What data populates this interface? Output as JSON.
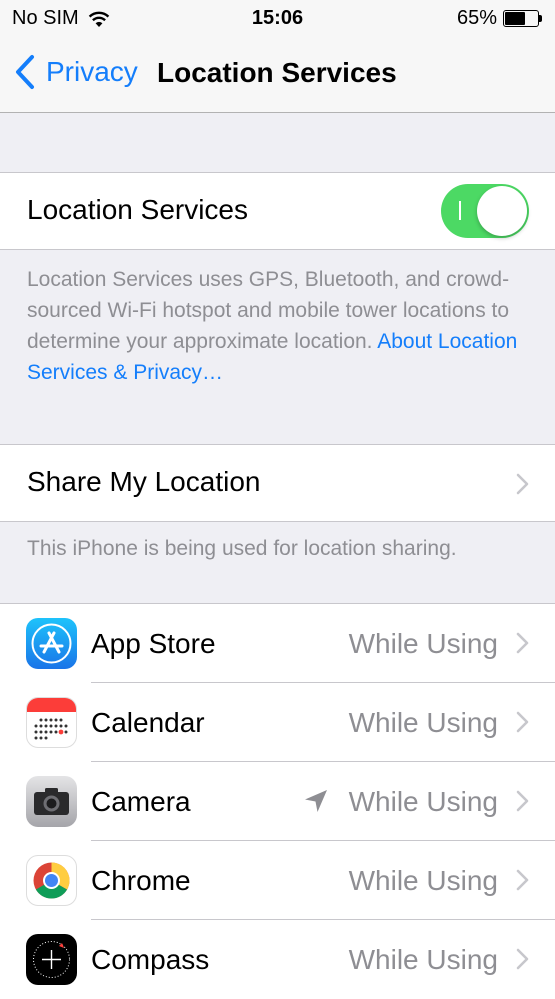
{
  "status_bar": {
    "carrier": "No SIM",
    "time": "15:06",
    "battery_percent_label": "65%",
    "battery_level": 0.65
  },
  "nav": {
    "back_label": "Privacy",
    "title": "Location Services"
  },
  "location_services": {
    "label": "Location Services",
    "enabled": true,
    "toggle_mark": "I",
    "description": "Location Services uses GPS, Bluetooth, and crowd-sourced Wi-Fi hotspot and mobile tower locations to determine your approximate location. ",
    "link": "About Location Services & Privacy…"
  },
  "share": {
    "label": "Share My Location",
    "footer": "This iPhone is being used for location sharing."
  },
  "apps": [
    {
      "name": "App Store",
      "value": "While Using",
      "icon": "app-store-icon"
    },
    {
      "name": "Calendar",
      "value": "While Using",
      "icon": "calendar-icon"
    },
    {
      "name": "Camera",
      "value": "While Using",
      "icon": "camera-icon",
      "recent_location": true
    },
    {
      "name": "Chrome",
      "value": "While Using",
      "icon": "chrome-icon"
    },
    {
      "name": "Compass",
      "value": "While Using",
      "icon": "compass-icon"
    }
  ],
  "colors": {
    "accent": "#147efb",
    "toggle_on": "#4cd964",
    "secondary_text": "#8e8e93",
    "background": "#efeff4"
  }
}
